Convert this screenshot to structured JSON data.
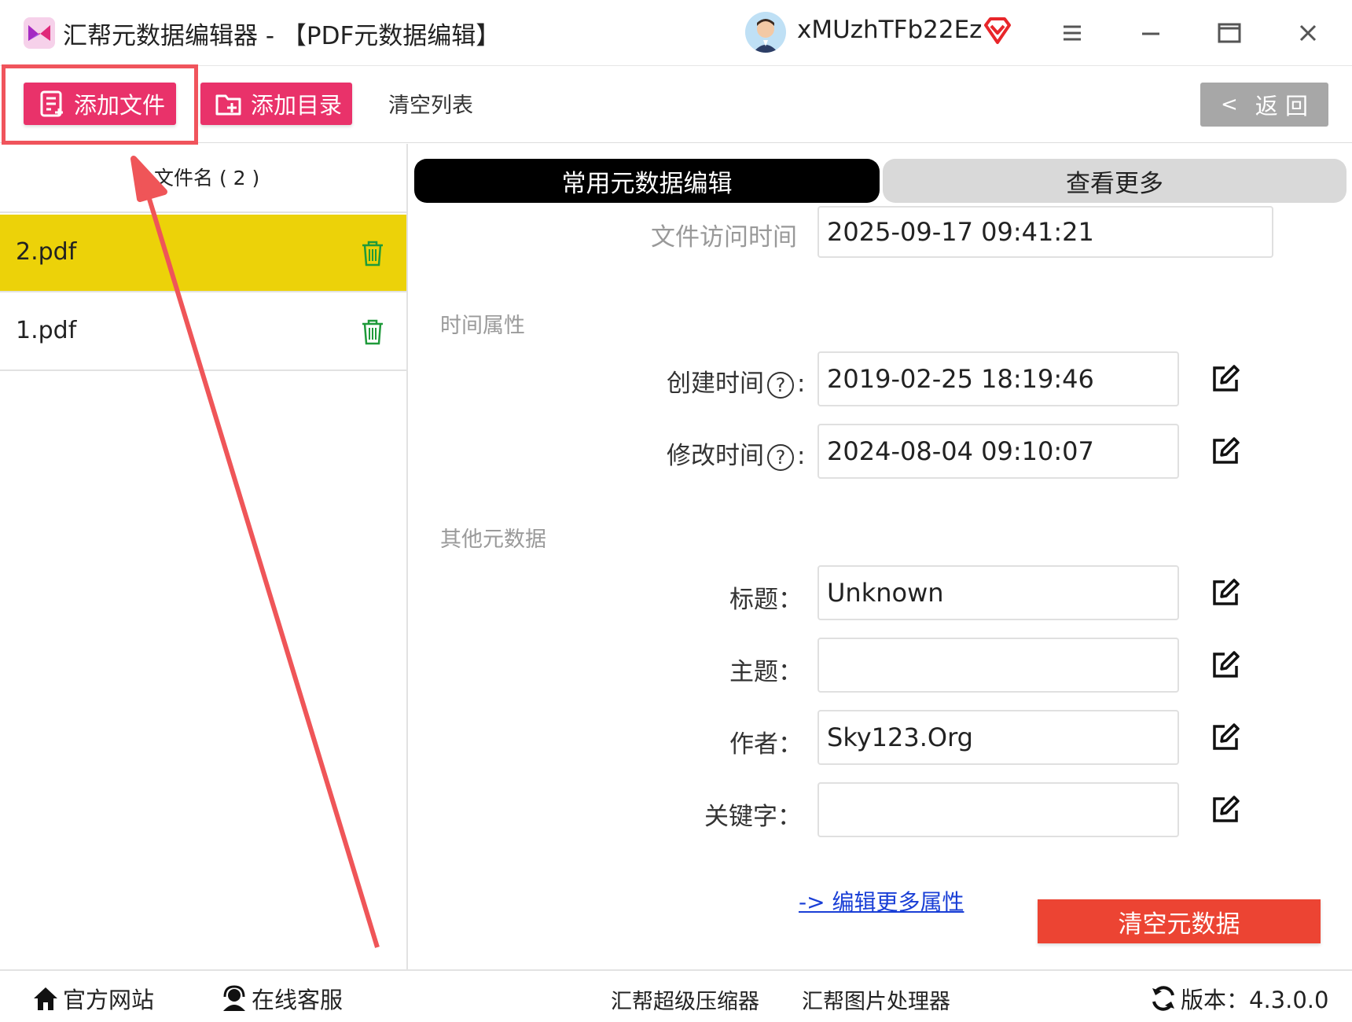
{
  "window": {
    "title": "汇帮元数据编辑器 - 【PDF元数据编辑】",
    "username": "xMUzhTFb22Ez",
    "accent": "#e9326a"
  },
  "toolbar": {
    "add_file": "添加文件",
    "add_folder": "添加目录",
    "clear_list": "清空列表",
    "back": "返 回",
    "back_chevron": "<"
  },
  "file_list": {
    "header": "文件名 ( 2 )",
    "files": [
      {
        "name": "2.pdf",
        "selected": true
      },
      {
        "name": "1.pdf",
        "selected": false
      }
    ]
  },
  "tabs": {
    "common": "常用元数据编辑",
    "more": "查看更多"
  },
  "fields": {
    "access_time_label": "文件访问时间",
    "access_time_value": "2025-09-17 09:41:21",
    "time_section": "时间属性",
    "created_label": "创建时间",
    "created_value": "2019-02-25 18:19:46",
    "modified_label": "修改时间",
    "modified_value": "2024-08-04 09:10:07",
    "help_glyph": "?",
    "colon": ":",
    "other_section": "其他元数据",
    "title_label": "标题：",
    "title_value": "Unknown",
    "subject_label": "主题：",
    "subject_value": "",
    "author_label": "作者：",
    "author_value": "Sky123.Org",
    "keywords_label": "关键字：",
    "keywords_value": ""
  },
  "actions": {
    "edit_more": "-> 编辑更多属性",
    "clear_metadata": "清空元数据"
  },
  "footer": {
    "website": "官方网站",
    "support": "在线客服",
    "compressor": "汇帮超级压缩器",
    "image_tool": "汇帮图片处理器",
    "version": "版本：4.3.0.0"
  }
}
